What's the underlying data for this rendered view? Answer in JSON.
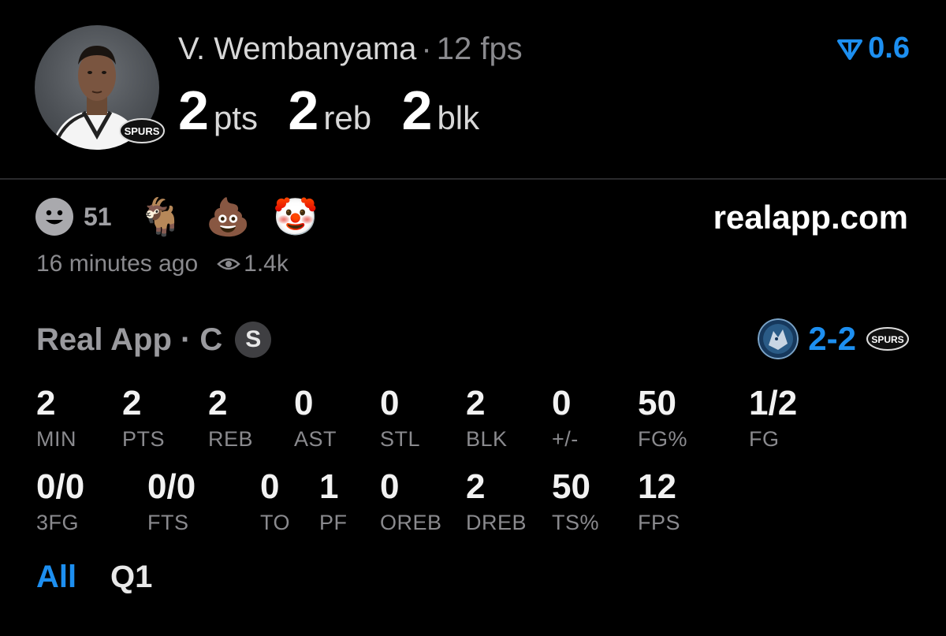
{
  "player": {
    "name": "V. Wembanyama",
    "separator": "·",
    "fps_label": "12 fps",
    "team_logo_text": "SPURS"
  },
  "headline_stats": [
    {
      "value": "2",
      "unit": "pts"
    },
    {
      "value": "2",
      "unit": "reb"
    },
    {
      "value": "2",
      "unit": "blk"
    }
  ],
  "rating": {
    "value": "0.6",
    "color": "#1d8ff0"
  },
  "reactions": {
    "count": "51",
    "emojis": [
      "🐐",
      "💩",
      "🤡"
    ]
  },
  "site": "realapp.com",
  "meta": {
    "time_ago": "16 minutes ago",
    "views": "1.4k"
  },
  "game": {
    "source": "Real App · C",
    "badge": "S",
    "score": "2-2",
    "away_logo_text": "SPURS"
  },
  "stats_row1": [
    {
      "value": "2",
      "label": "MIN"
    },
    {
      "value": "2",
      "label": "PTS"
    },
    {
      "value": "2",
      "label": "REB"
    },
    {
      "value": "0",
      "label": "AST"
    },
    {
      "value": "0",
      "label": "STL"
    },
    {
      "value": "2",
      "label": "BLK"
    },
    {
      "value": "0",
      "label": "+/-"
    },
    {
      "value": "50",
      "label": "FG%"
    },
    {
      "value": "1/2",
      "label": "FG"
    }
  ],
  "stats_row2": [
    {
      "value": "0/0",
      "label": "3FG"
    },
    {
      "value": "0/0",
      "label": "FTS"
    },
    {
      "value": "0",
      "label": "TO"
    },
    {
      "value": "1",
      "label": "PF"
    },
    {
      "value": "0",
      "label": "OREB"
    },
    {
      "value": "2",
      "label": "DREB"
    },
    {
      "value": "50",
      "label": "TS%"
    },
    {
      "value": "12",
      "label": "FPS"
    }
  ],
  "tabs": [
    {
      "label": "All",
      "active": true
    },
    {
      "label": "Q1",
      "active": false
    }
  ],
  "colors": {
    "accent": "#1d8ff0",
    "background": "#000000",
    "muted": "#8a8a8e"
  }
}
